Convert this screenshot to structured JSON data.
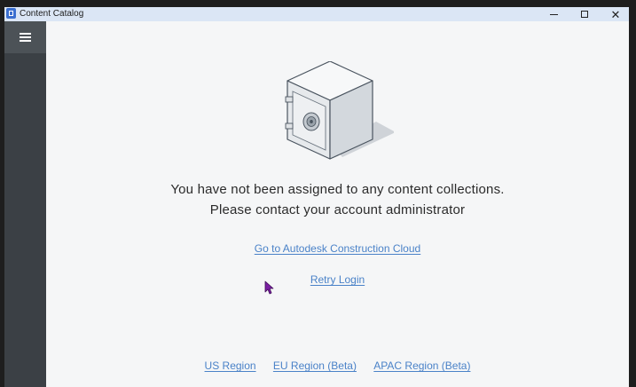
{
  "window": {
    "title": "Content Catalog",
    "controls": {
      "minimize": "minimize",
      "maximize": "maximize",
      "close": "close"
    }
  },
  "sidebar": {
    "menu_icon": "hamburger-menu-icon"
  },
  "main": {
    "illustration_icon": "safe-icon",
    "message_line1": "You have not been assigned to any content collections.",
    "message_line2": "Please contact your account administrator",
    "acc_link": "Go to Autodesk Construction Cloud",
    "retry_link": "Retry Login"
  },
  "regions": {
    "us": "US Region",
    "eu": "EU Region (Beta)",
    "apac": "APAC Region (Beta)"
  },
  "colors": {
    "link": "#4a82c8",
    "sidebar": "#3b4045",
    "titlebar": "#dbe6f5",
    "cursor": "#7a1fa2"
  }
}
